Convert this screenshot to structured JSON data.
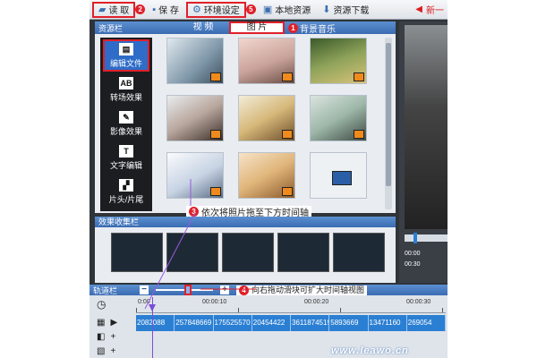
{
  "toolbar": {
    "read_label": "读 取",
    "read_step": "2",
    "save_label": "保 存",
    "env_label": "环境设定",
    "env_step": "5",
    "local_label": "本地资源",
    "download_label": "资源下载",
    "new_label": "新一"
  },
  "resource": {
    "title": "资源栏",
    "tabs": [
      "视 频",
      "图 片",
      "背景音乐"
    ],
    "active_tab": "图 片",
    "tab_step": "1",
    "sidebar": [
      {
        "label": "编辑文件",
        "icon": "film-icon",
        "glyph": "▤"
      },
      {
        "label": "转场效果",
        "icon": "transition-icon",
        "glyph": "AB"
      },
      {
        "label": "影像效果",
        "icon": "magic-wand-icon",
        "glyph": "✎"
      },
      {
        "label": "文字编辑",
        "icon": "text-icon",
        "glyph": "T"
      },
      {
        "label": "片头/片尾",
        "icon": "clapper-icon",
        "glyph": "▞"
      }
    ],
    "drag_step": "3",
    "drag_hint": "依次将照片拖至下方时间轴"
  },
  "effects": {
    "title": "效果收集栏"
  },
  "track": {
    "title": "轨道栏",
    "zoom_minus": "−",
    "zoom_plus": "+",
    "zoom_step": "4",
    "zoom_hint": "向右拖动滑块可扩大时间轴视图"
  },
  "timeline": {
    "ticks": [
      "0:00",
      "00:00:10",
      "00:00:20",
      "00:00:30"
    ],
    "clips": [
      "2082088",
      "257848669",
      "175525570",
      "20454422",
      "3611874519",
      "5893669",
      "13471160",
      "269054"
    ],
    "watermark": "www.leawo.cn"
  },
  "preview": {
    "time1": "00:00",
    "time2": "00:30"
  },
  "colors": {
    "accent_red": "#e0202a",
    "header_blue": "#3a6bb2",
    "clip_blue": "#2b7fd3"
  }
}
